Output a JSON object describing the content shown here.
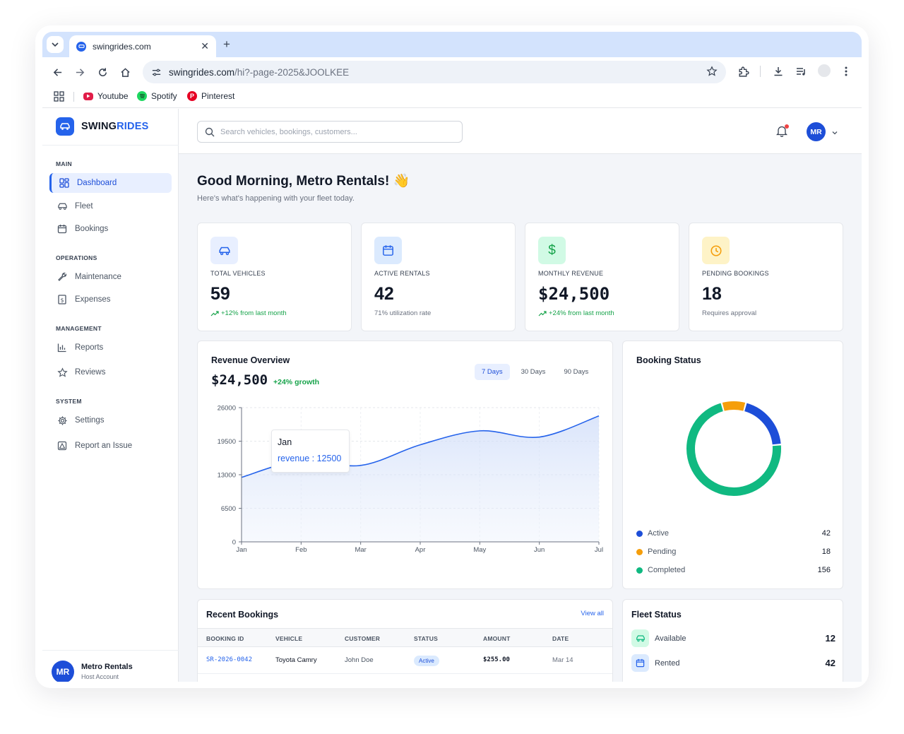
{
  "browser": {
    "tab_title": "swingrides.com",
    "url_host": "swingrides.com",
    "url_path": "/hi?-page-2025&JOOLKEE",
    "bookmarks": [
      {
        "label": "Youtube",
        "icon": "youtube-icon",
        "color": "#e11d48"
      },
      {
        "label": "Spotify",
        "icon": "spotify-icon",
        "color": "#1ed760"
      },
      {
        "label": "Pinterest",
        "icon": "pinterest-icon",
        "color": "#e60023"
      }
    ]
  },
  "brand": {
    "part1": "SWING",
    "part2": "RIDES",
    "color": "#2563eb"
  },
  "sidebar": {
    "sections": [
      {
        "label": "MAIN"
      },
      {
        "label": "OPERATIONS"
      },
      {
        "label": "MANAGEMENT"
      },
      {
        "label": "SYSTEM"
      }
    ],
    "items": [
      {
        "label": "Dashboard",
        "icon": "grid-icon",
        "active": true
      },
      {
        "label": "Fleet",
        "icon": "car-icon"
      },
      {
        "label": "Bookings",
        "icon": "calendar-icon"
      },
      {
        "label": "Maintenance",
        "icon": "wrench-icon"
      },
      {
        "label": "Expenses",
        "icon": "receipt-icon"
      },
      {
        "label": "Reports",
        "icon": "bar-chart-icon"
      },
      {
        "label": "Reviews",
        "icon": "star-icon"
      },
      {
        "label": "Settings",
        "icon": "gear-icon"
      },
      {
        "label": "Report an Issue",
        "icon": "warning-icon"
      }
    ],
    "account": {
      "initials": "MR",
      "name": "Metro Rentals",
      "role": "Host Account"
    }
  },
  "topbar": {
    "search_placeholder": "Search vehicles, bookings, customers...",
    "user_initials": "MR"
  },
  "greeting": {
    "title": "Good Morning, Metro Rentals! 👋",
    "subtitle": "Here's what's happening with your fleet today."
  },
  "stats": [
    {
      "label": "TOTAL VEHICLES",
      "value": "59",
      "note": "+12% from last month",
      "trend": "up",
      "icon": "car-icon",
      "accent": "#2563eb",
      "bg": "#e8efff"
    },
    {
      "label": "ACTIVE RENTALS",
      "value": "42",
      "note": "71% utilization rate",
      "icon": "calendar-icon",
      "accent": "#2563eb",
      "bg": "#dbeafe"
    },
    {
      "label": "MONTHLY REVENUE",
      "value": "$24,500",
      "note": "+24% from last month",
      "trend": "up",
      "icon": "dollar-icon",
      "accent": "#16a34a",
      "bg": "#d1fae5"
    },
    {
      "label": "PENDING BOOKINGS",
      "value": "18",
      "note": "Requires approval",
      "icon": "clock-icon",
      "accent": "#f59e0b",
      "bg": "#fef3c7"
    }
  ],
  "revenue": {
    "title": "Revenue Overview",
    "amount": "$24,500",
    "growth": "+24% growth",
    "ranges": [
      {
        "label": "7 Days",
        "active": true
      },
      {
        "label": "30 Days"
      },
      {
        "label": "90 Days"
      }
    ],
    "tooltip": {
      "title": "Jan",
      "text": "revenue : 12500"
    }
  },
  "chart_data": {
    "type": "area",
    "x": [
      "Jan",
      "Feb",
      "Mar",
      "Apr",
      "May",
      "Jun",
      "Jul"
    ],
    "series": [
      {
        "name": "revenue",
        "values": [
          12500,
          15800,
          14800,
          18800,
          21500,
          20300,
          24400
        ]
      }
    ],
    "yticks": [
      "26000",
      "19500",
      "13000",
      "6500",
      "0"
    ],
    "ylim": [
      0,
      26000
    ],
    "grid": true,
    "color": "#2563eb"
  },
  "booking_status": {
    "title": "Booking Status",
    "items": [
      {
        "label": "Active",
        "value": "42",
        "color": "#1d4ed8"
      },
      {
        "label": "Pending",
        "value": "18",
        "color": "#f59e0b"
      },
      {
        "label": "Completed",
        "value": "156",
        "color": "#10b981"
      }
    ]
  },
  "recent_bookings": {
    "title": "Recent Bookings",
    "view_all": "View all",
    "columns": [
      "BOOKING ID",
      "VEHICLE",
      "CUSTOMER",
      "STATUS",
      "AMOUNT",
      "DATE"
    ],
    "rows": [
      {
        "id": "SR-2026-0042",
        "vehicle": "Toyota Camry",
        "customer": "John Doe",
        "status": "Active",
        "amount": "$255.00",
        "date": "Mar 14"
      }
    ]
  },
  "fleet_status": {
    "title": "Fleet Status",
    "items": [
      {
        "label": "Available",
        "value": "12",
        "icon": "car-icon",
        "color": "#10b981",
        "bg": "#d1fae5"
      },
      {
        "label": "Rented",
        "value": "42",
        "icon": "calendar-icon",
        "color": "#2563eb",
        "bg": "#dbeafe"
      }
    ]
  }
}
